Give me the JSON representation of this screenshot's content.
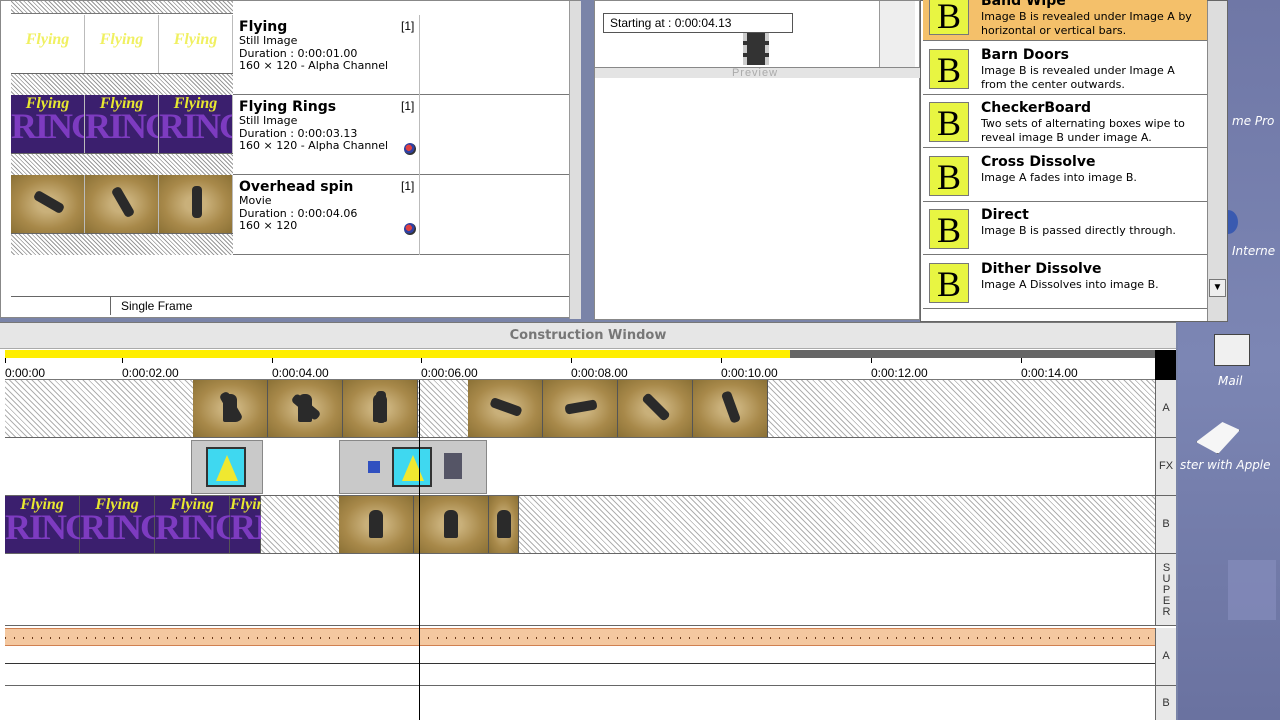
{
  "project": {
    "items": [
      {
        "name": "Flying",
        "type": "Still Image",
        "duration": "Duration : 0:00:01.00",
        "size": "160 × 120 - Alpha Channel",
        "count": "[1]",
        "thumb": "flying",
        "dot": false
      },
      {
        "name": "Flying Rings",
        "type": "Still Image",
        "duration": "Duration : 0:00:03.13",
        "size": "160 × 120 - Alpha Channel",
        "count": "[1]",
        "thumb": "rings",
        "dot": true
      },
      {
        "name": "Overhead spin",
        "type": "Movie",
        "duration": "Duration : 0:00:04.06",
        "size": "160 × 120",
        "count": "[1]",
        "thumb": "spin",
        "dot": true
      }
    ],
    "status_label": "Single Frame",
    "thumb_text_flying": "Flying",
    "thumb_text_ring": "RING"
  },
  "preview": {
    "starting_at": "Starting at : 0:00:04.13",
    "label": "Preview"
  },
  "transitions": [
    {
      "name": "Band Wipe",
      "desc": "Image B is revealed under Image A by horizontal or vertical bars.",
      "selected": true
    },
    {
      "name": "Barn Doors",
      "desc": "Image B is revealed under Image A from the center outwards.",
      "selected": false
    },
    {
      "name": "CheckerBoard",
      "desc": "Two sets of alternating boxes wipe to reveal image B under image A.",
      "selected": false
    },
    {
      "name": "Cross Dissolve",
      "desc": "Image A fades into image B.",
      "selected": false
    },
    {
      "name": "Direct",
      "desc": "Image B is passed directly through.",
      "selected": false
    },
    {
      "name": "Dither Dissolve",
      "desc": "Image A Dissolves into image B.",
      "selected": false
    }
  ],
  "transition_icon_letter": "B",
  "construction": {
    "title": "Construction Window",
    "ticks": [
      "0:00:00",
      "0:00:02.00",
      "0:00:04.00",
      "0:00:06.00",
      "0:00:08.00",
      "0:00:10.00",
      "0:00:12.00",
      "0:00:14.00"
    ],
    "track_labels": {
      "a": "A",
      "fx": "FX",
      "b": "B",
      "super": "SUPER",
      "audio_a": "A",
      "audio_b": "B"
    }
  },
  "desktop": {
    "label_top": "me Pro",
    "label_internet": "Interne",
    "label_mail": "Mail",
    "label_register": "ster with Apple"
  },
  "colors": {
    "accent_yellow": "#ffee00",
    "selected": "#f4c06a",
    "b_icon": "#e8f542"
  }
}
